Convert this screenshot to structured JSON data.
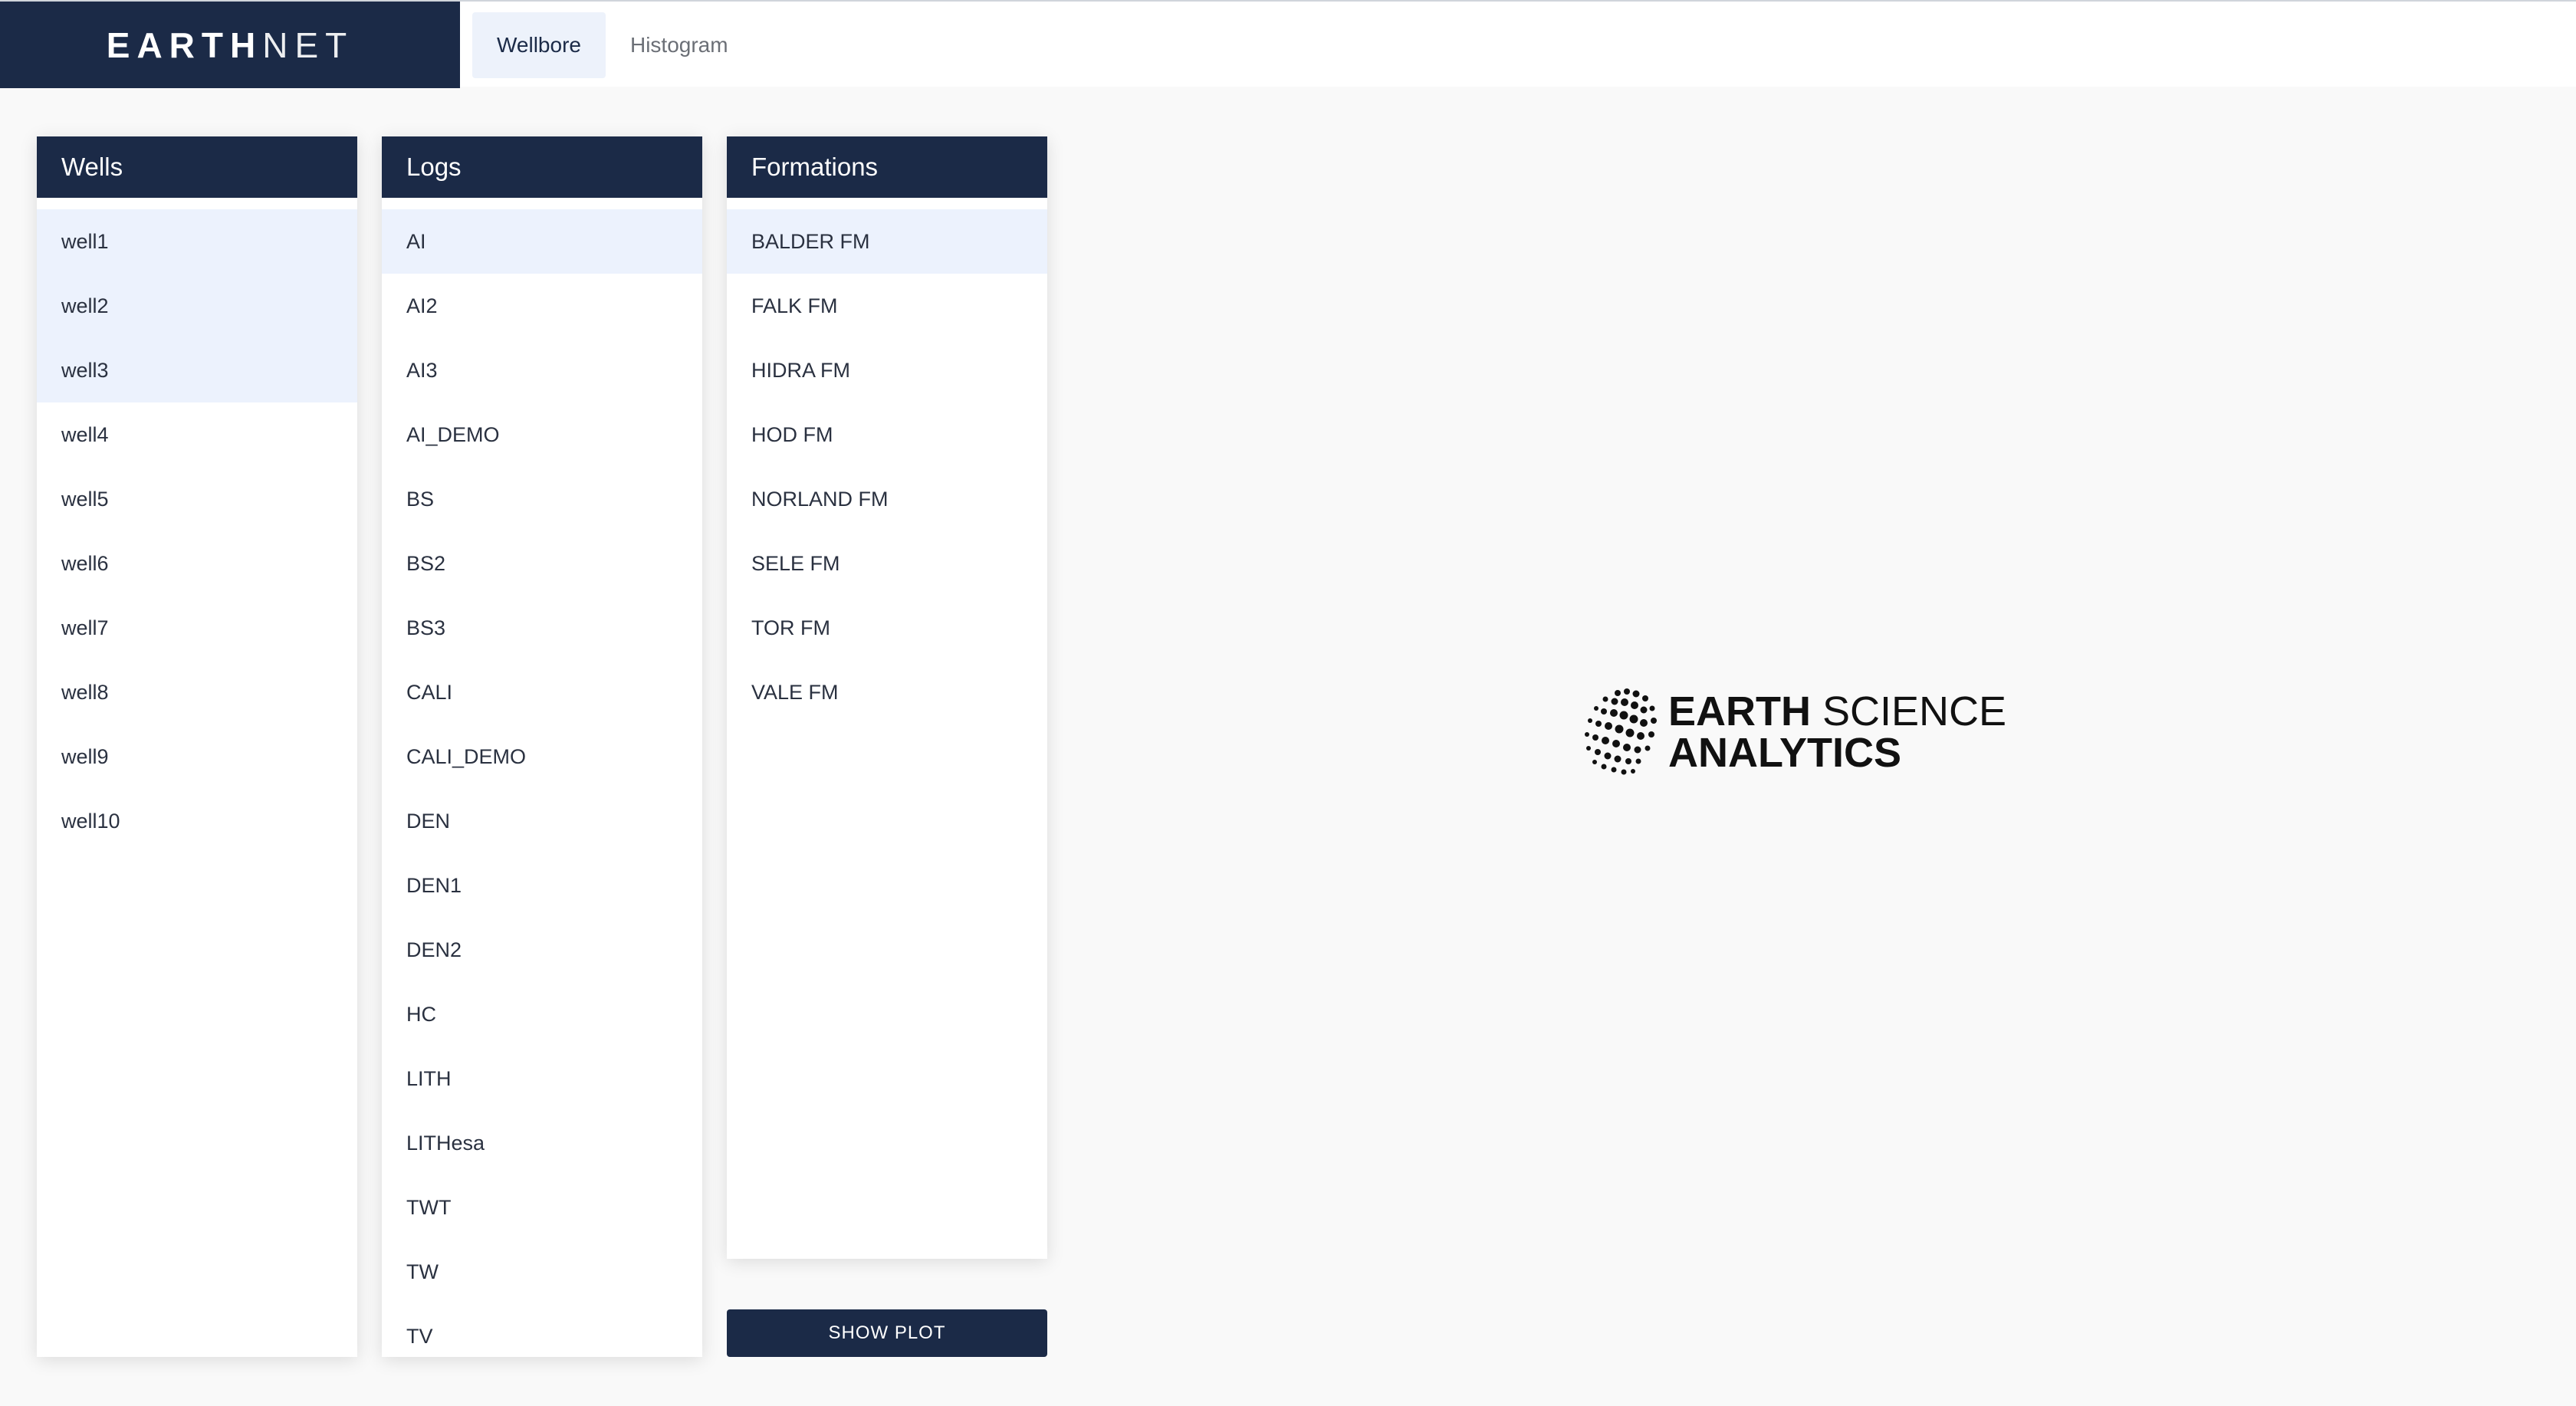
{
  "app": {
    "brand_bold": "EARTH",
    "brand_light": "NET"
  },
  "tabs": [
    {
      "label": "Wellbore",
      "active": true
    },
    {
      "label": "Histogram",
      "active": false
    }
  ],
  "wells": {
    "title": "Wells",
    "items": [
      {
        "label": "well1",
        "selected": true
      },
      {
        "label": "well2",
        "selected": true
      },
      {
        "label": "well3",
        "selected": true
      },
      {
        "label": "well4",
        "selected": false
      },
      {
        "label": "well5",
        "selected": false
      },
      {
        "label": "well6",
        "selected": false
      },
      {
        "label": "well7",
        "selected": false
      },
      {
        "label": "well8",
        "selected": false
      },
      {
        "label": "well9",
        "selected": false
      },
      {
        "label": "well10",
        "selected": false
      }
    ]
  },
  "logs": {
    "title": "Logs",
    "items": [
      {
        "label": "AI",
        "selected": true
      },
      {
        "label": "AI2",
        "selected": false
      },
      {
        "label": "AI3",
        "selected": false
      },
      {
        "label": "AI_DEMO",
        "selected": false
      },
      {
        "label": "BS",
        "selected": false
      },
      {
        "label": "BS2",
        "selected": false
      },
      {
        "label": "BS3",
        "selected": false
      },
      {
        "label": "CALI",
        "selected": false
      },
      {
        "label": "CALI_DEMO",
        "selected": false
      },
      {
        "label": "DEN",
        "selected": false
      },
      {
        "label": "DEN1",
        "selected": false
      },
      {
        "label": "DEN2",
        "selected": false
      },
      {
        "label": "HC",
        "selected": false
      },
      {
        "label": "LITH",
        "selected": false
      },
      {
        "label": "LITHesa",
        "selected": false
      },
      {
        "label": "TWT",
        "selected": false
      },
      {
        "label": "TW",
        "selected": false
      },
      {
        "label": "TV",
        "selected": false
      }
    ]
  },
  "formations": {
    "title": "Formations",
    "items": [
      {
        "label": "BALDER FM",
        "selected": true
      },
      {
        "label": "FALK FM",
        "selected": false
      },
      {
        "label": "HIDRA FM",
        "selected": false
      },
      {
        "label": "HOD FM",
        "selected": false
      },
      {
        "label": "NORLAND FM",
        "selected": false
      },
      {
        "label": "SELE FM",
        "selected": false
      },
      {
        "label": "TOR FM",
        "selected": false
      },
      {
        "label": "VALE FM",
        "selected": false
      }
    ]
  },
  "actions": {
    "show_plot_label": "SHOW PLOT"
  },
  "logo": {
    "line1_bold": "EARTH",
    "line1_light": " SCIENCE",
    "line2": "ANALYTICS",
    "icon": "dotted-globe-icon"
  },
  "colors": {
    "primary": "#1b2a47",
    "selected_bg": "#ecf2fd",
    "page_bg": "#f9f9f9"
  }
}
